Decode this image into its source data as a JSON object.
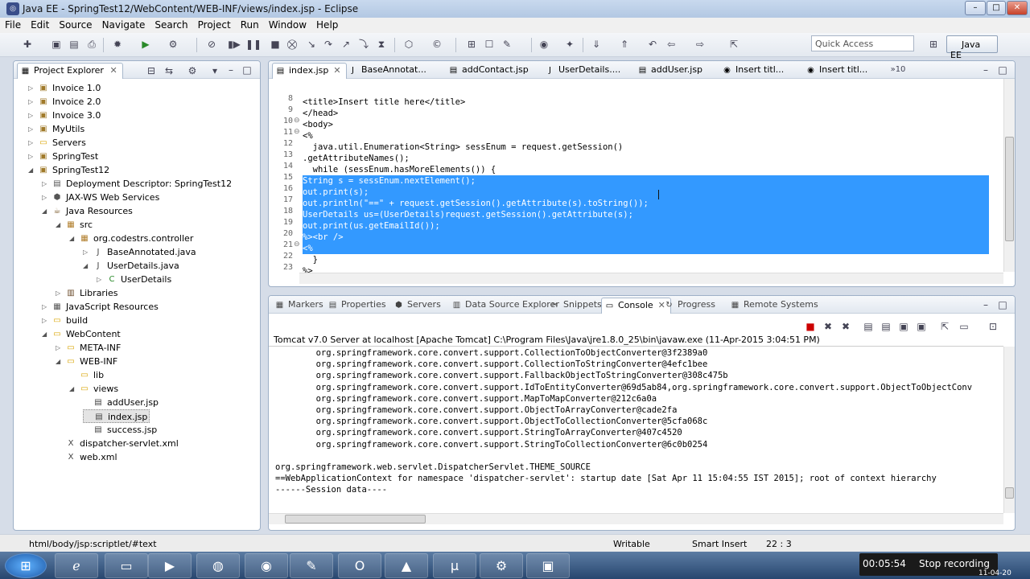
{
  "window": {
    "title": "Java EE - SpringTest12/WebContent/WEB-INF/views/index.jsp - Eclipse",
    "controls": [
      "–",
      "□",
      "✕"
    ]
  },
  "menu": [
    "File",
    "Edit",
    "Source",
    "Navigate",
    "Search",
    "Project",
    "Run",
    "Window",
    "Help"
  ],
  "toolbar": {
    "quick_access_placeholder": "Quick Access",
    "perspective": "Java EE"
  },
  "project_explorer": {
    "title": "Project Explorer",
    "items": [
      {
        "label": "Invoice 1.0",
        "depth": 0,
        "tw": "▷",
        "icon": "project-icon"
      },
      {
        "label": "Invoice 2.0",
        "depth": 0,
        "tw": "▷",
        "icon": "project-icon"
      },
      {
        "label": "Invoice 3.0",
        "depth": 0,
        "tw": "▷",
        "icon": "project-icon"
      },
      {
        "label": "MyUtils",
        "depth": 0,
        "tw": "▷",
        "icon": "project-icon"
      },
      {
        "label": "Servers",
        "depth": 0,
        "tw": "▷",
        "icon": "folder-icon"
      },
      {
        "label": "SpringTest",
        "depth": 0,
        "tw": "▷",
        "icon": "project-icon"
      },
      {
        "label": "SpringTest12",
        "depth": 0,
        "tw": "◢",
        "icon": "project-icon"
      },
      {
        "label": "Deployment Descriptor: SpringTest12",
        "depth": 1,
        "tw": "▷",
        "icon": "descriptor-icon"
      },
      {
        "label": "JAX-WS Web Services",
        "depth": 1,
        "tw": "▷",
        "icon": "webservice-icon"
      },
      {
        "label": "Java Resources",
        "depth": 1,
        "tw": "◢",
        "icon": "java-resources-icon"
      },
      {
        "label": "src",
        "depth": 2,
        "tw": "◢",
        "icon": "source-folder-icon"
      },
      {
        "label": "org.codestrs.controller",
        "depth": 3,
        "tw": "◢",
        "icon": "package-icon"
      },
      {
        "label": "BaseAnnotated.java",
        "depth": 4,
        "tw": "▷",
        "icon": "java-file-icon"
      },
      {
        "label": "UserDetails.java",
        "depth": 4,
        "tw": "◢",
        "icon": "java-file-icon"
      },
      {
        "label": "UserDetails",
        "depth": 5,
        "tw": "▷",
        "icon": "class-icon"
      },
      {
        "label": "Libraries",
        "depth": 2,
        "tw": "▷",
        "icon": "library-icon"
      },
      {
        "label": "JavaScript Resources",
        "depth": 1,
        "tw": "▷",
        "icon": "javascript-icon"
      },
      {
        "label": "build",
        "depth": 1,
        "tw": "▷",
        "icon": "folder-icon"
      },
      {
        "label": "WebContent",
        "depth": 1,
        "tw": "◢",
        "icon": "folder-icon"
      },
      {
        "label": "META-INF",
        "depth": 2,
        "tw": "▷",
        "icon": "folder-icon"
      },
      {
        "label": "WEB-INF",
        "depth": 2,
        "tw": "◢",
        "icon": "folder-icon"
      },
      {
        "label": "lib",
        "depth": 3,
        "tw": "",
        "icon": "folder-icon"
      },
      {
        "label": "views",
        "depth": 3,
        "tw": "◢",
        "icon": "folder-icon"
      },
      {
        "label": "addUser.jsp",
        "depth": 4,
        "tw": "",
        "icon": "jsp-file-icon"
      },
      {
        "label": "index.jsp",
        "depth": 4,
        "tw": "",
        "icon": "jsp-file-icon",
        "selected": true
      },
      {
        "label": "success.jsp",
        "depth": 4,
        "tw": "",
        "icon": "jsp-file-icon"
      },
      {
        "label": "dispatcher-servlet.xml",
        "depth": 2,
        "tw": "",
        "icon": "xml-file-icon"
      },
      {
        "label": "web.xml",
        "depth": 2,
        "tw": "",
        "icon": "xml-file-icon"
      }
    ]
  },
  "editor": {
    "tabs": [
      {
        "label": "index.jsp",
        "icon": "jsp-file-icon",
        "active": true,
        "close": "✕"
      },
      {
        "label": "BaseAnnotat...",
        "icon": "java-file-icon"
      },
      {
        "label": "addContact.jsp",
        "icon": "jsp-file-icon"
      },
      {
        "label": "UserDetails....",
        "icon": "java-file-icon"
      },
      {
        "label": "addUser.jsp",
        "icon": "jsp-file-icon"
      },
      {
        "label": "Insert titl...",
        "icon": "globe-icon"
      },
      {
        "label": "Insert titl...",
        "icon": "globe-icon"
      }
    ],
    "overflow": "»10",
    "lines": [
      {
        "n": "8",
        "code": "<title>Insert title here</title>",
        "hl": false,
        "fold": ""
      },
      {
        "n": "9",
        "code": "</head>",
        "hl": false,
        "fold": ""
      },
      {
        "n": "10",
        "code": "<body>",
        "hl": false,
        "fold": "⊖"
      },
      {
        "n": "11",
        "code": "<%",
        "hl": false,
        "fold": "⊖"
      },
      {
        "n": "12",
        "code": "  java.util.Enumeration<String> sessEnum = request.getSession()",
        "hl": false,
        "fold": ""
      },
      {
        "n": "13",
        "code": ".getAttributeNames();",
        "hl": false,
        "fold": ""
      },
      {
        "n": "14",
        "code": "  while (sessEnum.hasMoreElements()) {",
        "hl": false,
        "fold": ""
      },
      {
        "n": "15",
        "code": "String s = sessEnum.nextElement();",
        "hl": true,
        "fold": ""
      },
      {
        "n": "16",
        "code": "out.print(s);",
        "hl": true,
        "fold": ""
      },
      {
        "n": "17",
        "code": "out.println(\"==\" + request.getSession().getAttribute(s).toString());",
        "hl": true,
        "fold": ""
      },
      {
        "n": "18",
        "code": "UserDetails us=(UserDetails)request.getSession().getAttribute(s);",
        "hl": true,
        "fold": ""
      },
      {
        "n": "19",
        "code": "out.print(us.getEmailId());",
        "hl": true,
        "fold": ""
      },
      {
        "n": "20",
        "code": "%><br />",
        "hl": true,
        "fold": ""
      },
      {
        "n": "21",
        "code": "<%",
        "hl": true,
        "fold": "⊖"
      },
      {
        "n": "22",
        "code": "  }",
        "hl": false,
        "fold": ""
      },
      {
        "n": "23",
        "code": "%>",
        "hl": false,
        "fold": ""
      },
      {
        "n": "24",
        "code": "",
        "hl": false,
        "fold": ""
      }
    ]
  },
  "bottom": {
    "tabs": [
      {
        "label": "Markers",
        "icon": "markers-icon"
      },
      {
        "label": "Properties",
        "icon": "properties-icon"
      },
      {
        "label": "Servers",
        "icon": "servers-icon"
      },
      {
        "label": "Data Source Explorer",
        "icon": "datasource-icon"
      },
      {
        "label": "Snippets",
        "icon": "snippets-icon"
      },
      {
        "label": "Console",
        "icon": "console-icon",
        "active": true,
        "close": "✕"
      },
      {
        "label": "Progress",
        "icon": "progress-icon"
      },
      {
        "label": "Remote Systems",
        "icon": "remote-systems-icon"
      }
    ],
    "console_header": "Tomcat v7.0 Server at localhost [Apache Tomcat] C:\\Program Files\\Java\\jre1.8.0_25\\bin\\javaw.exe (11-Apr-2015 3:04:51 PM)",
    "console_lines": [
      "        org.springframework.core.convert.support.CollectionToObjectConverter@3f2389a0",
      "        org.springframework.core.convert.support.CollectionToStringConverter@4efc1bee",
      "        org.springframework.core.convert.support.FallbackObjectToStringConverter@308c475b",
      "        org.springframework.core.convert.support.IdToEntityConverter@69d5ab84,org.springframework.core.convert.support.ObjectToObjectConv",
      "        org.springframework.core.convert.support.MapToMapConverter@212c6a0a",
      "        org.springframework.core.convert.support.ObjectToArrayConverter@cade2fa",
      "        org.springframework.core.convert.support.ObjectToCollectionConverter@5cfa068c",
      "        org.springframework.core.convert.support.StringToArrayConverter@407c4520",
      "        org.springframework.core.convert.support.StringToCollectionConverter@6c0b0254",
      "",
      "org.springframework.web.servlet.DispatcherServlet.THEME_SOURCE",
      "==WebApplicationContext for namespace 'dispatcher-servlet': startup date [Sat Apr 11 15:04:55 IST 2015]; root of context hierarchy",
      "------Session data----"
    ]
  },
  "status": {
    "path": "html/body/jsp:scriptlet/#text",
    "writable": "Writable",
    "insert": "Smart Insert",
    "position": "22 : 3"
  },
  "taskbar": {
    "timer": "00:05:54",
    "stop_label": "Stop recording",
    "clock": "11-04-20"
  }
}
